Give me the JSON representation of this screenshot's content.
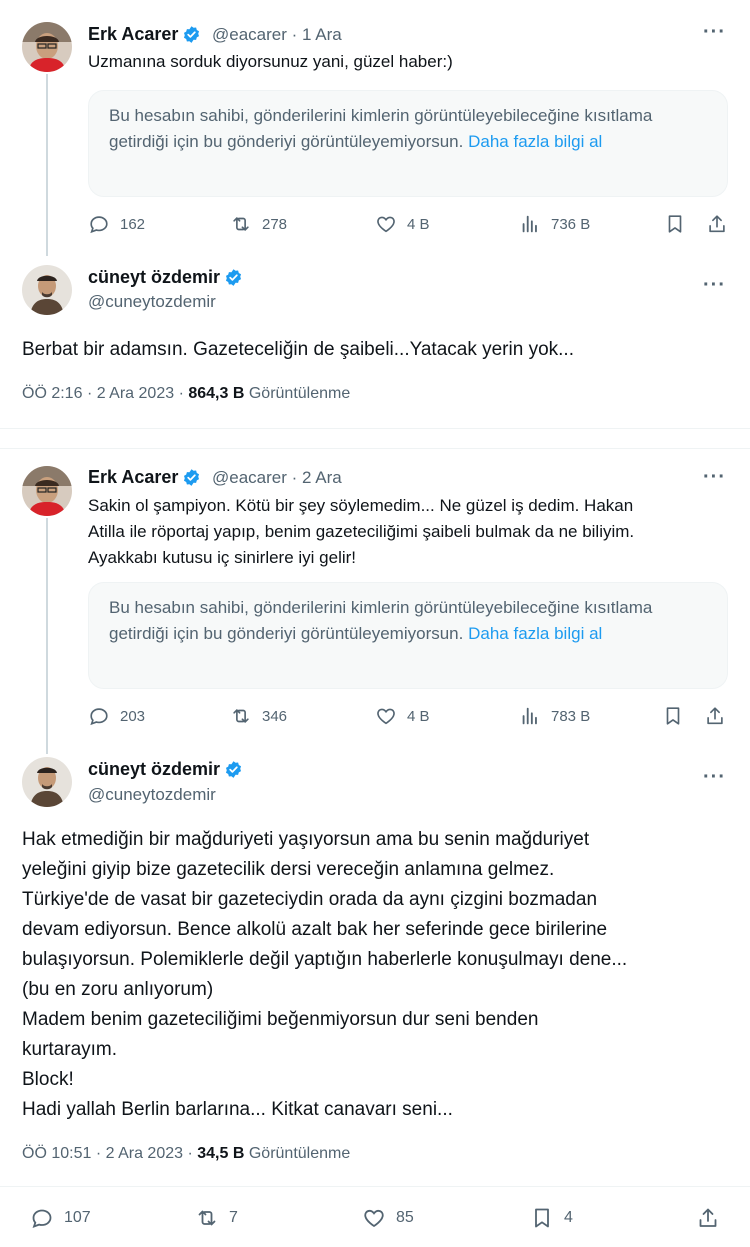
{
  "tweet1": {
    "name": "Erk Acarer",
    "handle": "@eacarer",
    "separator": "·",
    "time": "1 Ara",
    "more": "···",
    "text": "Uzmanına sorduk diyorsunuz yani, güzel haber:)",
    "notice": "Bu hesabın sahibi, gönderilerini kimlerin görüntüleyebileceğine kısıtlama getirdiği için bu gönderiyi görüntüleyemiyorsun.",
    "notice_link": "Daha fazla bilgi al",
    "replies": "162",
    "reposts": "278",
    "likes": "4 B",
    "views": "736 B"
  },
  "reply1": {
    "name": "cüneyt özdemir",
    "handle": "@cuneytozdemir",
    "more": "···",
    "text": "Berbat bir adamsın. Gazeteceliğin de şaibeli...Yatacak yerin yok...",
    "time": "ÖÖ 2:16",
    "date": "2 Ara 2023",
    "views": "864,3 B",
    "views_label": "Görüntülenme"
  },
  "tweet2": {
    "name": "Erk Acarer",
    "handle": "@eacarer",
    "separator": "·",
    "time": "2 Ara",
    "more": "···",
    "text_lines": [
      "Sakin ol şampiyon. Kötü bir şey söylemedim... Ne güzel iş dedim. Hakan",
      "Atilla ile röportaj yapıp, benim gazeteciliğimi şaibeli bulmak da ne biliyim.",
      "Ayakkabı kutusu iç sinirlere iyi gelir!"
    ],
    "notice": "Bu hesabın sahibi, gönderilerini kimlerin görüntüleyebileceğine kısıtlama getirdiği için bu gönderiyi görüntüleyemiyorsun.",
    "notice_link": "Daha fazla bilgi al",
    "replies": "203",
    "reposts": "346",
    "likes": "4 B",
    "views": "783 B"
  },
  "reply2": {
    "name": "cüneyt özdemir",
    "handle": "@cuneytozdemir",
    "more": "···",
    "text_lines": [
      "Hak etmediğin bir mağduriyeti yaşıyorsun ama bu senin mağduriyet",
      "yeleğini giyip bize gazetecilik dersi  vereceğin anlamına gelmez.",
      "Türkiye'de de vasat bir gazeteciydin orada da aynı çizgini bozmadan",
      "devam ediyorsun. Bence alkolü azalt bak her seferinde gece birilerine",
      "bulaşıyorsun. Polemiklerle değil yaptığın haberlerle konuşulmayı dene...",
      "(bu en zoru anlıyorum)",
      "Madem benim gazeteciliğimi beğenmiyorsun dur seni benden",
      "kurtarayım.",
      "Block!",
      "Hadi yallah Berlin barlarına... Kitkat canavarı seni..."
    ],
    "time": "ÖÖ 10:51",
    "date": "2 Ara 2023",
    "views": "34,5 B",
    "views_label": "Görüntülenme",
    "replies": "107",
    "reposts": "7",
    "likes": "85",
    "bookmarks": "4"
  },
  "colors": {
    "accent": "#1d9bf0",
    "muted": "#536471",
    "text": "#0f1419"
  }
}
